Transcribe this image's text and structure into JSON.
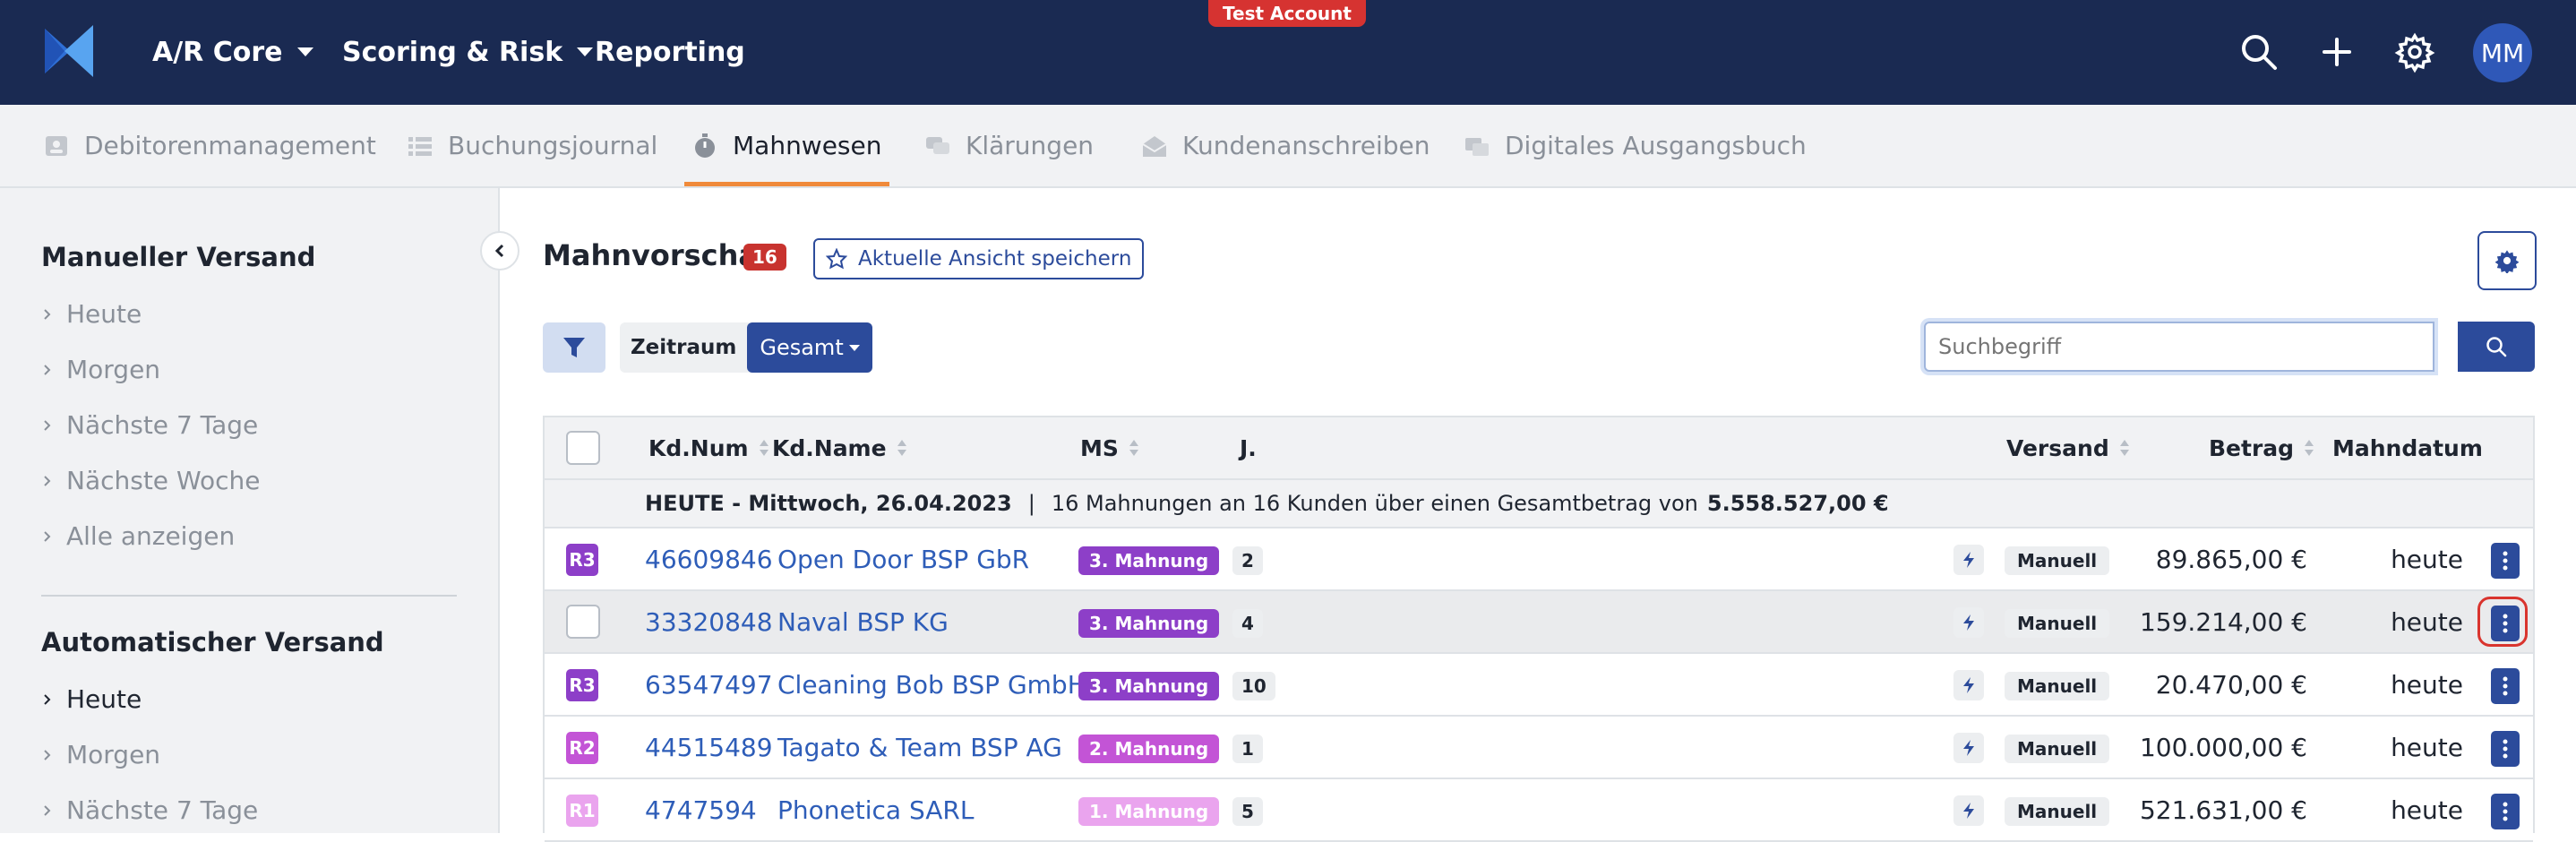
{
  "topbar": {
    "nav": [
      {
        "label": "A/R Core",
        "dropdown": true
      },
      {
        "label": "Scoring & Risk",
        "dropdown": true
      },
      {
        "label": "Reporting",
        "dropdown": false
      }
    ],
    "test_badge": "Test Account",
    "icons": [
      "search-icon",
      "plus-icon",
      "gear-icon"
    ],
    "avatar_initials": "MM"
  },
  "subnav": {
    "tabs": [
      {
        "label": "Debitorenmanagement",
        "icon": "id-card-icon"
      },
      {
        "label": "Buchungsjournal",
        "icon": "list-icon"
      },
      {
        "label": "Mahnwesen",
        "icon": "stopwatch-icon",
        "active": true
      },
      {
        "label": "Klärungen",
        "icon": "chat-icon"
      },
      {
        "label": "Kundenanschreiben",
        "icon": "envelope-open-icon"
      },
      {
        "label": "Digitales Ausgangsbuch",
        "icon": "mail-stack-icon"
      }
    ]
  },
  "sidebar": {
    "manual": {
      "heading": "Manueller Versand",
      "items": [
        "Heute",
        "Morgen",
        "Nächste 7 Tage",
        "Nächste Woche",
        "Alle anzeigen"
      ]
    },
    "auto": {
      "heading": "Automatischer Versand",
      "items": [
        "Heute",
        "Morgen",
        "Nächste 7 Tage"
      ],
      "active_index": 0
    }
  },
  "main": {
    "title": "Mahnvorschau",
    "count": "16",
    "save_view_label": "Aktuelle Ansicht speichern",
    "filter": {
      "zeitraum_label": "Zeitraum",
      "gesamt_label": "Gesamt"
    },
    "search": {
      "placeholder": "Suchbegriff"
    }
  },
  "table": {
    "columns": {
      "kdnum": "Kd.Num",
      "kdname": "Kd.Name",
      "ms": "MS",
      "j": "J.",
      "versand": "Versand",
      "betrag": "Betrag",
      "mahndatum": "Mahndatum"
    },
    "group": {
      "label": "HEUTE - Mittwoch, 26.04.2023",
      "separator": "|",
      "summary": "16 Mahnungen an 16 Kunden über einen Gesamtbetrag von",
      "total": "5.558.527,00 €"
    },
    "rows": [
      {
        "level": "R3",
        "level_color": "#8d3fc8",
        "kdnum": "46609846",
        "kdname": "Open Door BSP GbR",
        "ms": "3. Mahnung",
        "ms_color": "#8d3fc8",
        "j": "2",
        "versand": "Manuell",
        "betrag": "89.865,00 €",
        "mahndatum": "heute"
      },
      {
        "level": "",
        "level_color": "",
        "kdnum": "33320848",
        "kdname": "Naval BSP KG",
        "ms": "3. Mahnung",
        "ms_color": "#8d3fc8",
        "j": "4",
        "versand": "Manuell",
        "betrag": "159.214,00 €",
        "mahndatum": "heute",
        "highlight": true
      },
      {
        "level": "R3",
        "level_color": "#8d3fc8",
        "kdnum": "63547497",
        "kdname": "Cleaning Bob BSP GmbH",
        "ms": "3. Mahnung",
        "ms_color": "#8d3fc8",
        "j": "10",
        "versand": "Manuell",
        "betrag": "20.470,00 €",
        "mahndatum": "heute"
      },
      {
        "level": "R2",
        "level_color": "#c354d6",
        "kdnum": "44515489",
        "kdname": "Tagato & Team BSP AG",
        "ms": "2. Mahnung",
        "ms_color": "#c354d6",
        "j": "1",
        "versand": "Manuell",
        "betrag": "100.000,00 €",
        "mahndatum": "heute"
      },
      {
        "level": "R1",
        "level_color": "#eaa4ee",
        "kdnum": "4747594",
        "kdname": "Phonetica SARL",
        "ms": "1. Mahnung",
        "ms_color": "#eaa4ee",
        "j": "5",
        "versand": "Manuell",
        "betrag": "521.631,00 €",
        "mahndatum": "heute"
      }
    ]
  }
}
